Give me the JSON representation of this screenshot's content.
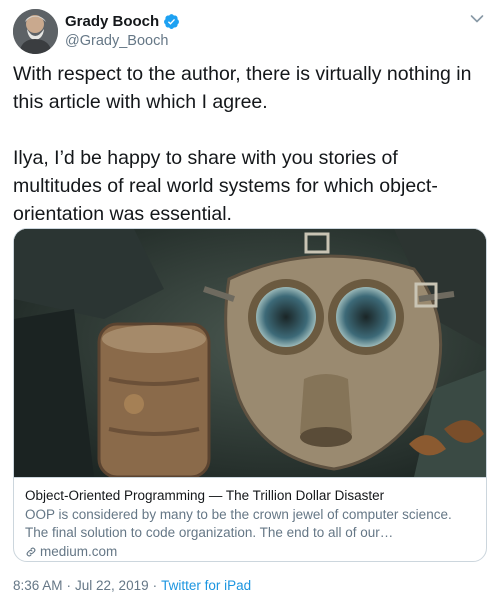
{
  "author": {
    "display_name": "Grady Booch",
    "handle": "@Grady_Booch",
    "verified_icon": "verified-badge-icon",
    "avatar_icon": "avatar-photo"
  },
  "tweet": {
    "paragraphs": [
      "With respect to the author, there is virtually nothing in this article with which I agree.",
      "Ilya, I’d be happy to share with you stories of multitudes of real world systems for which object-orientation was essential."
    ]
  },
  "card": {
    "image_icon": "gas-mask-photo",
    "title": "Object-Oriented Programming — The Trillion Dollar Disaster",
    "description": "OOP is considered by many to be the crown jewel of computer science. The final solution to code organization. The end to all of our…",
    "domain": "medium.com",
    "domain_icon": "link-icon"
  },
  "meta": {
    "time": "8:36 AM",
    "date": "Jul 22, 2019",
    "separator": "·",
    "source": "Twitter for iPad"
  },
  "colors": {
    "text": "#14171a",
    "secondary": "#657786",
    "link": "#1b95e0",
    "verified": "#1da1f2",
    "border": "#ccd6dd"
  }
}
